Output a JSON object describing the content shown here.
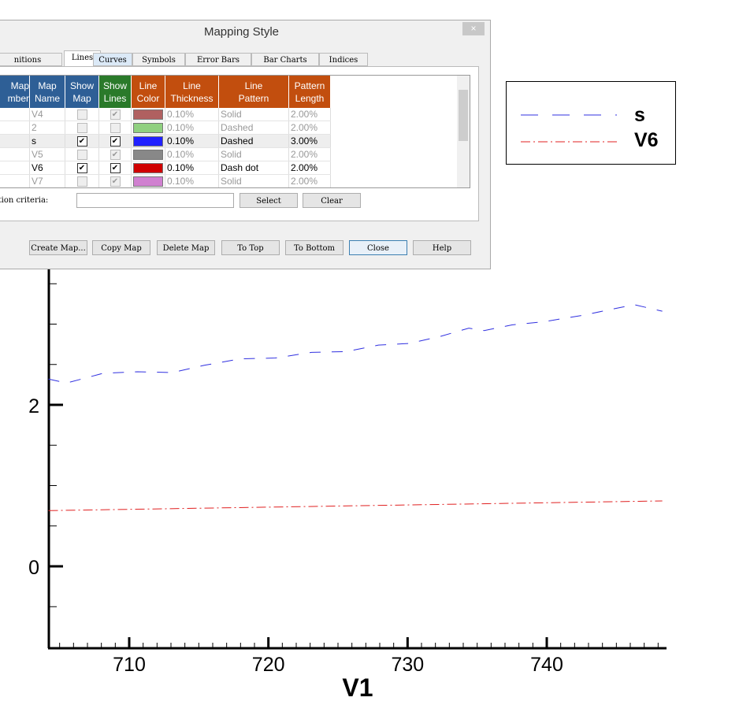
{
  "dialog": {
    "title": "Mapping Style",
    "close": "×",
    "tabs": [
      "nitions",
      "Lines",
      "Curves",
      "Symbols",
      "Error Bars",
      "Bar Charts",
      "Indices"
    ],
    "headers": [
      [
        "Map",
        "mber"
      ],
      [
        "Map",
        "Name"
      ],
      [
        "Show",
        "Map"
      ],
      [
        "Show",
        "Lines"
      ],
      [
        "Line",
        "Color"
      ],
      [
        "Line",
        "Thickness"
      ],
      [
        "Line",
        "Pattern"
      ],
      [
        "Pattern",
        "Length"
      ]
    ],
    "header_colors": [
      "#2e5f96",
      "#2e5f96",
      "#2e5f96",
      "#2a7a2a",
      "#c24e0e",
      "#c24e0e",
      "#c24e0e",
      "#c24e0e"
    ],
    "rows": [
      {
        "name": "V4",
        "show_map": false,
        "show_lines": true,
        "color": "#b06060",
        "thickness": "0.10%",
        "pattern": "Solid",
        "length": "2.00%",
        "active": false
      },
      {
        "name": "2",
        "show_map": false,
        "show_lines": false,
        "color": "#90d080",
        "thickness": "0.10%",
        "pattern": "Dashed",
        "length": "2.00%",
        "active": false
      },
      {
        "name": "s",
        "show_map": true,
        "show_lines": true,
        "color": "#2020ff",
        "thickness": "0.10%",
        "pattern": "Dashed",
        "length": "3.00%",
        "active": true
      },
      {
        "name": "V5",
        "show_map": false,
        "show_lines": true,
        "color": "#888888",
        "thickness": "0.10%",
        "pattern": "Solid",
        "length": "2.00%",
        "active": false
      },
      {
        "name": "V6",
        "show_map": true,
        "show_lines": true,
        "color": "#d00000",
        "thickness": "0.10%",
        "pattern": "Dash dot",
        "length": "2.00%",
        "active": true
      },
      {
        "name": "V7",
        "show_map": false,
        "show_lines": true,
        "color": "#d080d0",
        "thickness": "0.10%",
        "pattern": "Solid",
        "length": "2.00%",
        "active": false
      }
    ],
    "criteria_label": "ction criteria:",
    "criteria_value": "",
    "select": "Select",
    "clear": "Clear",
    "buttons": [
      "Create Map...",
      "Copy Map",
      "Delete Map",
      "To Top",
      "To Bottom",
      "Close",
      "Help"
    ]
  },
  "chart_data": {
    "type": "line",
    "xlabel": "V1",
    "xlim": [
      704.2,
      748.3
    ],
    "ylim": [
      -1,
      4
    ],
    "xticks": [
      710,
      720,
      730,
      740
    ],
    "yticks": [
      0,
      2
    ],
    "series": [
      {
        "name": "s",
        "color": "#3030e0",
        "dash": "14,14",
        "x": [
          704.2,
          705.5,
          708.1,
          710.6,
          713.1,
          715.4,
          718,
          720.5,
          723.1,
          725.6,
          727.9,
          730.1,
          732.4,
          734.4,
          735.5,
          737.5,
          739.8,
          742.6,
          745.4,
          746.3,
          748.3
        ],
        "y": [
          2.32,
          2.27,
          2.39,
          2.41,
          2.4,
          2.49,
          2.57,
          2.58,
          2.65,
          2.66,
          2.74,
          2.76,
          2.85,
          2.95,
          2.92,
          2.99,
          3.03,
          3.11,
          3.21,
          3.24,
          3.16
        ]
      },
      {
        "name": "V6",
        "color": "#e02020",
        "dash": "12,4,2,4",
        "x": [
          704.2,
          748.3
        ],
        "y": [
          0.69,
          0.81
        ]
      }
    ]
  }
}
